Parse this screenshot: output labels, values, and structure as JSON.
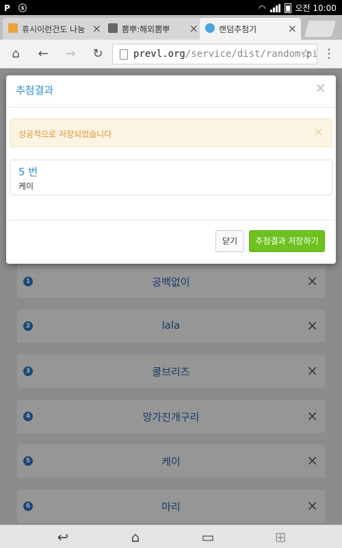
{
  "status_bar": {
    "left_icons": [
      "P",
      "ⓢ"
    ],
    "time": "오전 10:00",
    "battery_label": "71"
  },
  "tabs": [
    {
      "title": "휴시이런건도 나눔",
      "favicon_color": "#e8a33a"
    },
    {
      "title": "뽐뿌:해외뽐뿌",
      "favicon_color": "#666666"
    },
    {
      "title": "랜덤추첨기",
      "favicon_color": "#4aa3df"
    }
  ],
  "toolbar": {
    "url_host": "prevl.org",
    "url_path": "/service/dist/random-pick"
  },
  "list": {
    "items": [
      {
        "num": "1",
        "name": "공백없이"
      },
      {
        "num": "2",
        "name": "lala"
      },
      {
        "num": "3",
        "name": "쿨브리즈"
      },
      {
        "num": "4",
        "name": "망가진개구리"
      },
      {
        "num": "5",
        "name": "케이"
      },
      {
        "num": "6",
        "name": "마리"
      }
    ]
  },
  "modal": {
    "title": "추첨결과",
    "alert_text": "성공적으로 저장되었습니다",
    "result_number": "5 번",
    "result_name": "케이",
    "close_button": "닫기",
    "save_button": "추첨결과 저장하기"
  },
  "colors": {
    "accent": "#2d8fd0",
    "save": "#6ec21f",
    "alert_text": "#e09030"
  }
}
